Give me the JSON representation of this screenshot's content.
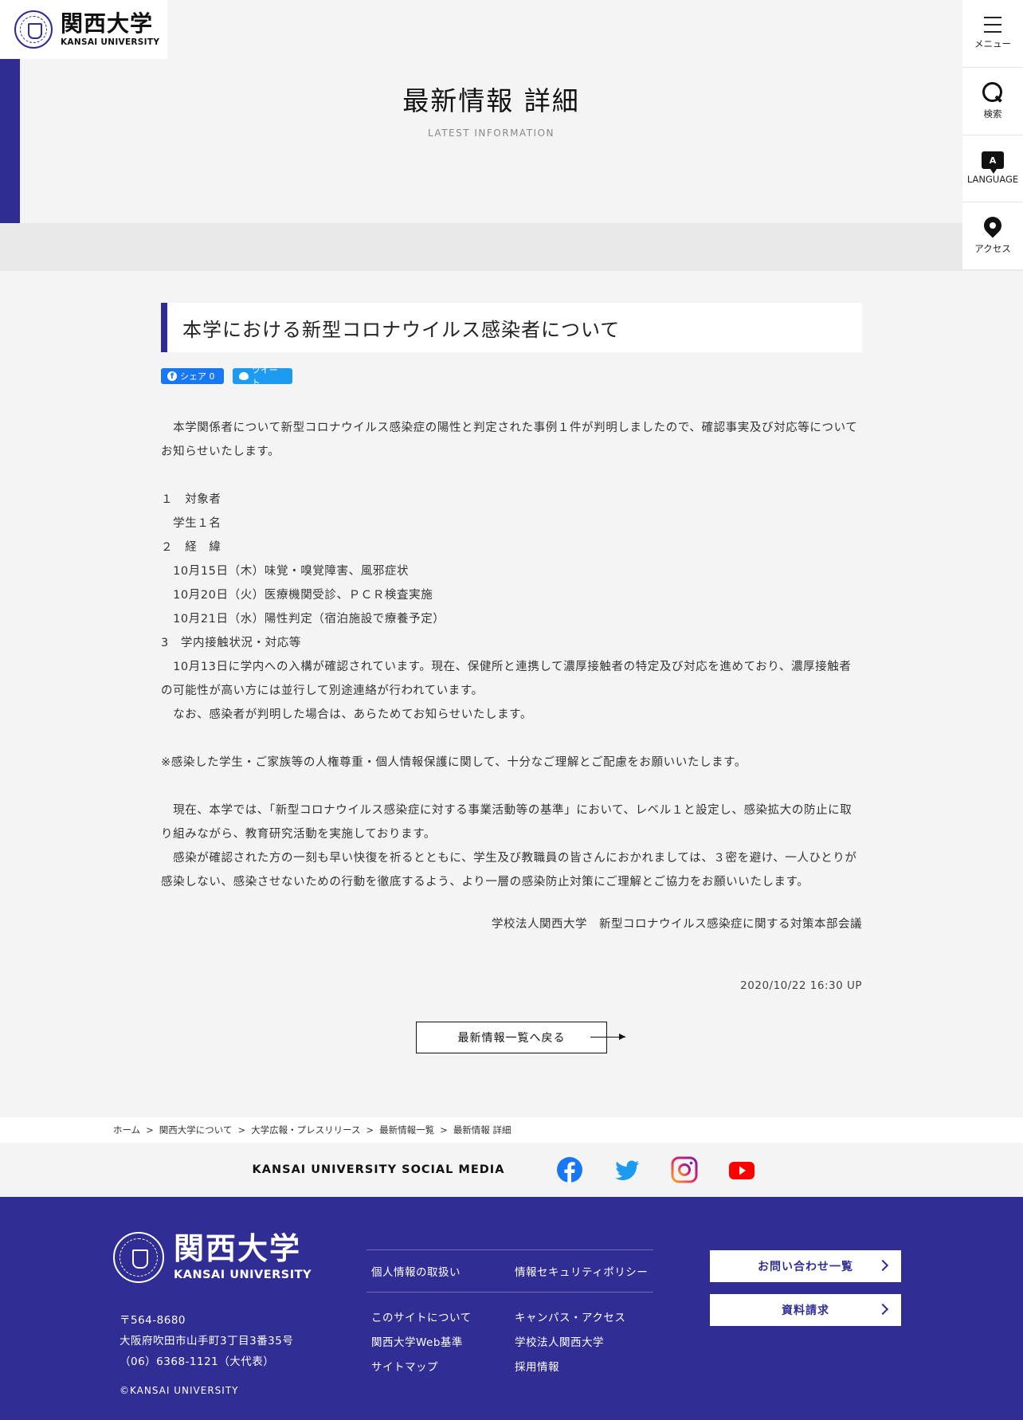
{
  "header": {
    "logo_jp": "関西大学",
    "logo_en": "KANSAI UNIVERSITY"
  },
  "page": {
    "title": "最新情報 詳細",
    "subtitle": "LATEST INFORMATION"
  },
  "side_menu": {
    "menu": "メニュー",
    "search": "検索",
    "language": "LANGUAGE",
    "language_icon": "A",
    "access": "アクセス"
  },
  "article": {
    "title": "本学における新型コロナウイルス感染者について",
    "share": {
      "facebook": "シェア 0",
      "twitter": "ツイート"
    },
    "body": [
      "　本学関係者について新型コロナウイルス感染症の陽性と判定された事例１件が判明しましたので、確認事実及び対応等についてお知らせいたします。",
      "",
      "１　対象者",
      "　学生１名",
      "２　経　緯",
      "　10月15日（木）味覚・嗅覚障害、風邪症状",
      "　10月20日（火）医療機関受診、ＰＣＲ検査実施",
      "　10月21日（水）陽性判定（宿泊施設で療養予定）",
      "3　学内接触状況・対応等",
      "　10月13日に学内への入構が確認されています。現在、保健所と連携して濃厚接触者の特定及び対応を進めており、濃厚接触者の可能性が高い方には並行して別途連絡が行われています。",
      "　なお、感染者が判明した場合は、あらためてお知らせいたします。",
      "",
      "※感染した学生・ご家族等の人権尊重・個人情報保護に関して、十分なご理解とご配慮をお願いいたします。",
      "",
      "　現在、本学では、「新型コロナウイルス感染症に対する事業活動等の基準」において、レベル１と設定し、感染拡大の防止に取り組みながら、教育研究活動を実施しております。",
      "　感染が確認された方の一刻も早い快復を祈るとともに、学生及び教職員の皆さんにおかれましては、３密を避け、一人ひとりが感染しない、感染させないための行動を徹底するよう、より一層の感染防止対策にご理解とご協力をお願いいたします。"
    ],
    "signature": "学校法人関西大学　新型コロナウイルス感染症に関する対策本部会議",
    "timestamp": "2020/10/22 16:30 UP",
    "back_button": "最新情報一覧へ戻る"
  },
  "breadcrumb": [
    "ホーム",
    "関西大学について",
    "大学広報・プレスリリース",
    "最新情報一覧",
    "最新情報 詳細"
  ],
  "breadcrumb_sep": ">",
  "social": {
    "label": "KANSAI UNIVERSITY SOCIAL MEDIA",
    "icons": [
      "facebook-icon",
      "twitter-icon",
      "instagram-icon",
      "youtube-icon"
    ]
  },
  "footer": {
    "logo_jp": "関西大学",
    "logo_en": "KANSAI UNIVERSITY",
    "address": [
      "〒564-8680",
      "大阪府吹田市山手町3丁目3番35号",
      "（06）6368-1121（大代表）"
    ],
    "copyright": "©KANSAI UNIVERSITY",
    "links_top": [
      "個人情報の取扱い",
      "情報セキュリティポリシー"
    ],
    "links": [
      [
        "このサイトについて",
        "キャンパス・アクセス"
      ],
      [
        "関西大学Web基準",
        "学校法人関西大学"
      ],
      [
        "サイトマップ",
        "採用情報"
      ]
    ],
    "buttons": [
      "お問い合わせ一覧",
      "資料請求"
    ]
  },
  "colors": {
    "brand": "#302d94",
    "facebook": "#1877f2",
    "twitter": "#1d9bf0",
    "youtube": "#ff0000"
  }
}
